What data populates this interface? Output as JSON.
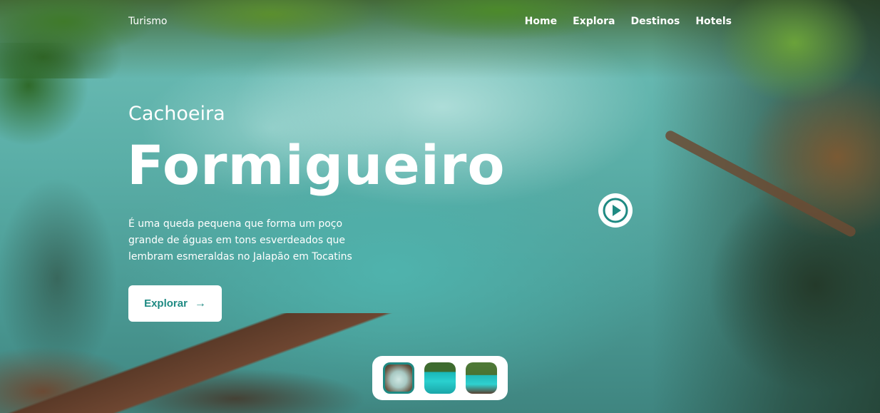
{
  "header": {
    "brand": "Turismo",
    "nav": [
      "Home",
      "Explora",
      "Destinos",
      "Hotels"
    ]
  },
  "hero": {
    "subtitle": "Cachoeira",
    "title": "Formigueiro",
    "description": "É uma queda pequena que forma um poço grande de águas em tons esverdeados que lembram esmeraldas no Jalapão em Tocatins",
    "cta_label": "Explorar",
    "cta_icon": "arrow-right-icon",
    "play_icon": "play-circle-icon"
  },
  "thumbnails": {
    "count": 3,
    "selected": 1
  },
  "colors": {
    "accent": "#1f8a83",
    "text_on_image": "#ffffff",
    "button_bg": "#ffffff"
  }
}
